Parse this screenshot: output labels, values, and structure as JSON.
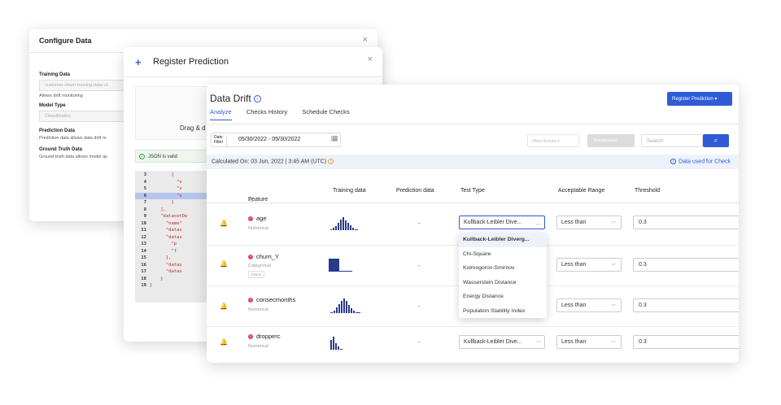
{
  "configure": {
    "title": "Configure Data",
    "close": "×",
    "training_label": "Training Data",
    "training_value": "customer-churn-training-data-v1",
    "training_note": "Allows drift monitoring",
    "model_type_label": "Model Type",
    "model_type_value": "Classification",
    "prediction_label": "Prediction Data",
    "prediction_note": "Prediction data allows data drift m",
    "ground_label": "Ground Truth Data",
    "ground_note": "Ground truth data allows model qu"
  },
  "register": {
    "plus": "+",
    "title": "Register Prediction",
    "close": "×",
    "drag_text": "Drag & d",
    "json_valid": "JSON is valid",
    "code_lines": [
      {
        "n": "3",
        "t": "        {",
        "hl": false
      },
      {
        "n": "4",
        "t": "          \"v",
        "hl": false
      },
      {
        "n": "5",
        "t": "          \"v",
        "hl": false
      },
      {
        "n": "6",
        "t": "          \"n",
        "hl": true
      },
      {
        "n": "7",
        "t": "        }",
        "hl": false
      },
      {
        "n": "8",
        "t": "    ],",
        "hl": false
      },
      {
        "n": "9",
        "t": "    \"datasetDe",
        "hl": false
      },
      {
        "n": "10",
        "t": "      \"name\"",
        "hl": false
      },
      {
        "n": "11",
        "t": "      \"datas",
        "hl": false
      },
      {
        "n": "12",
        "t": "      \"datas",
        "hl": false
      },
      {
        "n": "13",
        "t": "        \"p",
        "hl": false
      },
      {
        "n": "14",
        "t": "        \"f",
        "hl": false
      },
      {
        "n": "15",
        "t": "      },",
        "hl": false
      },
      {
        "n": "16",
        "t": "      \"datas",
        "hl": false
      },
      {
        "n": "17",
        "t": "      \"datas",
        "hl": false
      },
      {
        "n": "18",
        "t": "    }",
        "hl": false
      },
      {
        "n": "19",
        "t": "}",
        "hl": false
      }
    ]
  },
  "drift": {
    "title": "Data Drift",
    "info_icon": "ⓘ",
    "tabs": [
      "Analyze",
      "Checks History",
      "Schedule Checks"
    ],
    "register_btn": "Register Prediction",
    "date_label": "Date\nFilter",
    "date_value": "05/30/2022  -  05/30/2022",
    "other_actions": "Other Actions",
    "recalculate": "Recalculate",
    "search_placeholder": "Search",
    "calculated": "Calculated On: 03 Jun, 2022 | 3:45 AM (UTC)",
    "data_used": "Data used for Check",
    "columns": {
      "feature": "Feature",
      "training": "Training data",
      "prediction": "Prediction data",
      "test_type": "Test Type",
      "range": "Acceptable Range",
      "threshold": "Threshold"
    },
    "rows": [
      {
        "name": "age",
        "type": "Numerical",
        "prediction": "-",
        "test": "Kullback-Leibler Dive...",
        "range": "Less than",
        "threshold": "0.3"
      },
      {
        "name": "churn_Y",
        "type": "Categorical",
        "tag": "Output",
        "prediction": "-",
        "test": "",
        "range": "Less than",
        "threshold": "0.3"
      },
      {
        "name": "consecmonths",
        "type": "Numerical",
        "prediction": "-",
        "test": "",
        "range": "Less than",
        "threshold": "0.3"
      },
      {
        "name": "dropperc",
        "type": "Numerical",
        "prediction": "-",
        "test": "Kullback-Leibler Dive...",
        "range": "Less than",
        "threshold": "0.3"
      }
    ],
    "test_options": [
      "Kullback-Leibler Diverg...",
      "Chi-Square",
      "Kolmogorov-Smirnov",
      "Wasserstein Distance",
      "Energy Distance",
      "Population Stability Index"
    ],
    "accent_color": "#2f5bd6"
  }
}
